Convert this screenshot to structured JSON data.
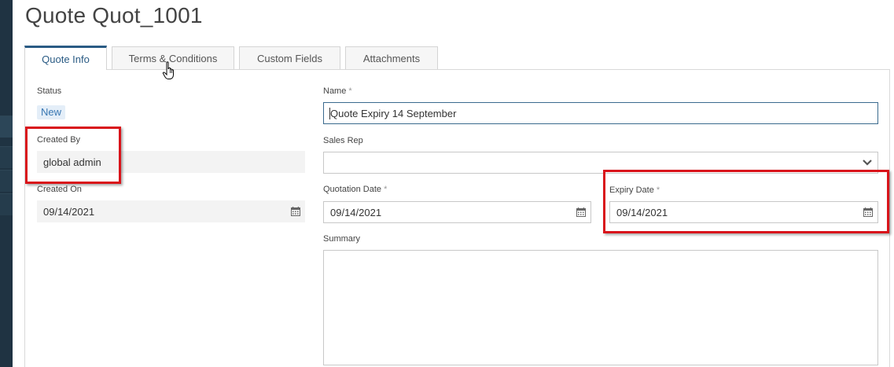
{
  "page": {
    "title": "Quote Quot_1001"
  },
  "tabs": [
    {
      "label": "Quote Info",
      "active": true
    },
    {
      "label": "Terms & Conditions",
      "active": false
    },
    {
      "label": "Custom Fields",
      "active": false
    },
    {
      "label": "Attachments",
      "active": false
    }
  ],
  "form": {
    "status": {
      "label": "Status",
      "value": "New"
    },
    "created_by": {
      "label": "Created By",
      "value": "global admin"
    },
    "created_on": {
      "label": "Created On",
      "value": "09/14/2021",
      "icon": "calendar-icon"
    },
    "name": {
      "label": "Name",
      "required_mark": "*",
      "value": "Quote Expiry 14 September"
    },
    "sales_rep": {
      "label": "Sales Rep",
      "value": "",
      "icon": "chevron-down-icon"
    },
    "quotation_date": {
      "label": "Quotation Date",
      "required_mark": "*",
      "value": "09/14/2021",
      "icon": "calendar-icon"
    },
    "expiry_date": {
      "label": "Expiry Date",
      "required_mark": "*",
      "value": "09/14/2021",
      "icon": "calendar-icon"
    },
    "summary": {
      "label": "Summary",
      "value": ""
    }
  },
  "colors": {
    "accent": "#2a5b84",
    "highlight": "#d9141b",
    "badge_bg": "#e4eef8",
    "badge_text": "#3a78b3",
    "rail": "#1f3342"
  }
}
